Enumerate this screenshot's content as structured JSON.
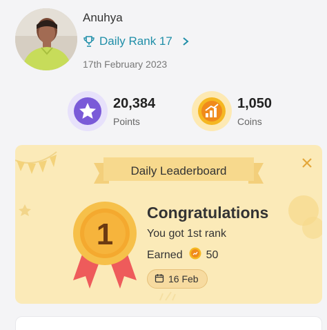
{
  "profile": {
    "name": "Anuhya",
    "rank_label": "Daily Rank 17",
    "date": "17th February 2023",
    "avatar_icon": "person-photo",
    "rank_icon": "trophy-icon",
    "accent": "#1f8ea8"
  },
  "stats": {
    "points": {
      "value": "20,384",
      "label": "Points",
      "icon": "star-icon",
      "color": "#7a5ad8"
    },
    "coins": {
      "value": "1,050",
      "label": "Coins",
      "icon": "coin-growth-icon",
      "color": "#f5b721"
    }
  },
  "leaderboard_card": {
    "banner_title": "Daily Leaderboard",
    "medal_number": "1",
    "title": "Congratulations",
    "subtitle": "You got 1st rank",
    "earned_label": "Earned",
    "earned_amount": "50",
    "date_chip": "16 Feb",
    "background": "#fbeab8"
  }
}
